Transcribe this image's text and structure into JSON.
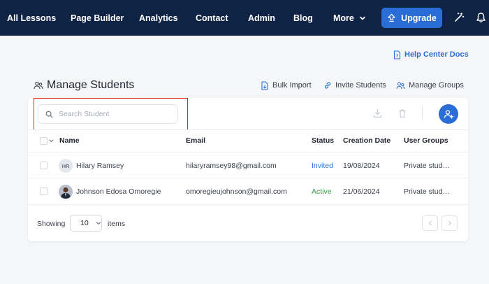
{
  "topnav": {
    "items": [
      "All Lessons",
      "Page Builder",
      "Analytics",
      "Contact",
      "Admin",
      "Blog",
      "More"
    ],
    "upgrade_label": "Upgrade",
    "magic_icon": "magic-wand-icon",
    "bell_icon": "bell-icon"
  },
  "help": {
    "label": "Help Center Docs"
  },
  "page": {
    "title": "Manage Students",
    "actions": {
      "bulk_import": "Bulk Import",
      "invite": "Invite Students",
      "manage_groups": "Manage Groups"
    }
  },
  "search": {
    "placeholder": "Search Student",
    "value": ""
  },
  "table": {
    "columns": [
      "Name",
      "Email",
      "Status",
      "Creation Date",
      "User Groups"
    ],
    "rows": [
      {
        "initials": "HR",
        "name": "Hilary Ramsey",
        "email": "hilaryramsey98@gmail.com",
        "status": "Invited",
        "date": "19/08/2024",
        "groups": "Private stud…"
      },
      {
        "initials": "",
        "name": "Johnson Edosa Omoregie",
        "email": "omoregieujohnson@gmail.com",
        "status": "Active",
        "date": "21/06/2024",
        "groups": "Private stud…"
      }
    ]
  },
  "pagination": {
    "showing_label": "Showing",
    "per_page": "10",
    "items_label": "items"
  },
  "colors": {
    "nav_bg": "#0f2345",
    "accent": "#2b6dd6",
    "active": "#2f9e44",
    "highlight": "#e02424"
  }
}
